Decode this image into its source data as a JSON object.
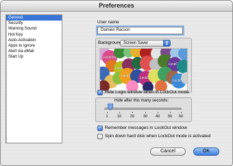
{
  "window": {
    "title": "Preferences"
  },
  "sidebar": {
    "items": [
      {
        "label": "General",
        "selected": true
      },
      {
        "label": "Security",
        "selected": false
      },
      {
        "label": "Warning Sound",
        "selected": false
      },
      {
        "label": "Hot Key",
        "selected": false
      },
      {
        "label": "Auto-Activation",
        "selected": false
      },
      {
        "label": "Apps to Ignore",
        "selected": false
      },
      {
        "label": "Alert via eMail",
        "selected": false
      },
      {
        "label": "Start Up",
        "selected": false
      }
    ]
  },
  "user_name": {
    "label": "User name",
    "value": "Damien Racson"
  },
  "background": {
    "label": "Background",
    "selected_option": "Screen Saver",
    "preview_text": "LockOut"
  },
  "hide_login": {
    "label": "Hide Login window when in LockOut mode",
    "checked": true,
    "slider_caption": "Hide after this many seconds:",
    "slider_value": 10,
    "ticks": [
      "1",
      "10",
      "20",
      "30",
      "40",
      "50",
      "60"
    ]
  },
  "remember_messages": {
    "label": "Remember messages in LockOut window",
    "checked": true
  },
  "spin_down": {
    "label": "Spin down hard disk when LockOut mode is activated",
    "checked": false
  },
  "buttons": {
    "cancel": "Cancel",
    "ok": "OK"
  },
  "colors": {
    "selection": "#3875d7",
    "default_button": "#3b7de0"
  }
}
